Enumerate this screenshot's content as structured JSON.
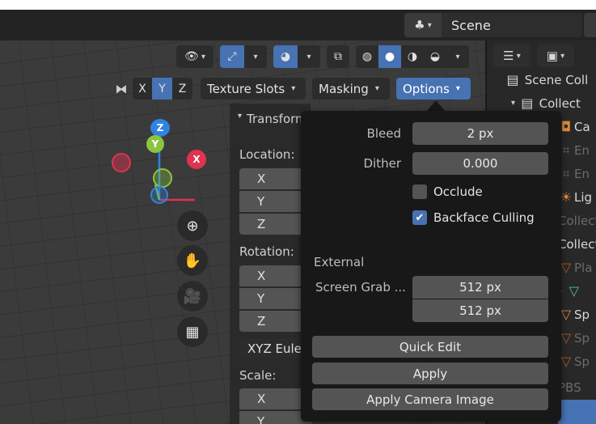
{
  "top_bar": {
    "scene_label": "Scene"
  },
  "viewport_header": {
    "axis_buttons": [
      "X",
      "Y",
      "Z"
    ],
    "texture_slots_label": "Texture Slots",
    "masking_label": "Masking",
    "options_label": "Options"
  },
  "gizmo": {
    "x_label": "X",
    "y_label": "Y",
    "z_label": "Z"
  },
  "n_panel": {
    "transform_header": "Transform",
    "location_label": "Location:",
    "rotation_label": "Rotation:",
    "scale_label": "Scale:",
    "x": "X",
    "y": "Y",
    "z": "Z",
    "rotation_mode": "XYZ Euler"
  },
  "popover": {
    "bleed_label": "Bleed",
    "bleed_value": "2 px",
    "dither_label": "Dither",
    "dither_value": "0.000",
    "occlude_label": "Occlude",
    "occlude_checked": false,
    "backface_label": "Backface Culling",
    "backface_checked": true,
    "external_header": "External",
    "screen_grab_label": "Screen Grab ...",
    "screen_grab_x": "512 px",
    "screen_grab_y": "512 px",
    "quick_edit_label": "Quick Edit",
    "apply_label": "Apply",
    "apply_camera_label": "Apply Camera Image"
  },
  "outliner": {
    "scene_collection": "Scene Coll",
    "collection": "Collect",
    "items": [
      "Ca",
      "En",
      "En",
      "Lig",
      "Collect",
      "Collect",
      "Pla",
      "",
      "Sp",
      "Sp",
      "Sp",
      "PBS"
    ]
  },
  "colors": {
    "accent": "#4772b3",
    "axis_x": "#e0334f",
    "axis_y": "#8bc53f",
    "axis_z": "#2f84e2"
  }
}
